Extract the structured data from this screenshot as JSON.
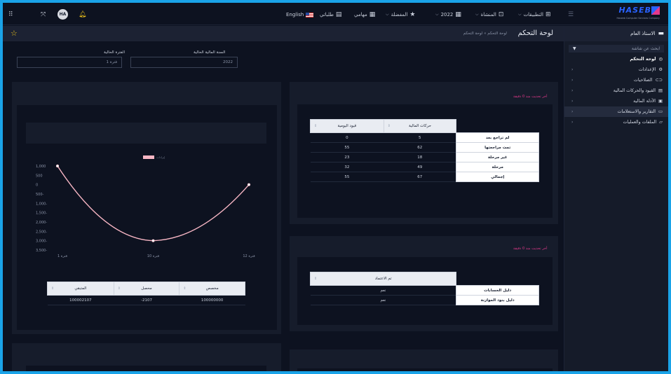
{
  "topbar": {
    "language": "English",
    "print_label": "طلباتي",
    "tasks_label": "مهامي",
    "year_label": "2022",
    "favorites_label": "المفضلة",
    "facility_label": "المنشاة",
    "apps_label": "التطبيقات",
    "avatar_initials": "HA",
    "logo_word": "HASEB",
    "logo_sub": "Haseeb Computer Services Company"
  },
  "breadcrumb": {
    "title": "لوحة التحكم",
    "path": "لوحة التحكم  »  لوحة التحكم"
  },
  "sidebar": {
    "header": "الاستاذ العام",
    "search_placeholder": "ابحث عن شاشة",
    "items": [
      {
        "label": "لوحة التحكم",
        "chevron": false
      },
      {
        "label": "الإعدادات",
        "chevron": true
      },
      {
        "label": "الصلاحيات",
        "chevron": true
      },
      {
        "label": "القيود والحركات المالية",
        "chevron": true
      },
      {
        "label": "الأدلة المالية",
        "chevron": true
      },
      {
        "label": "التقارير والاستعلامات",
        "chevron": true
      },
      {
        "label": "الملفات والعمليات",
        "chevron": true
      }
    ]
  },
  "filters": {
    "year_label": "السنة المالية الحالية",
    "year_value": "2022",
    "period_label": "الفترة الحالية",
    "period_value": "فترة 1"
  },
  "status_table": {
    "updated": "أخر تحديث منذ 0 دقيقة",
    "columns": [
      "حركات المالية",
      "قيود اليومية"
    ],
    "rows": [
      {
        "label": "لم تراجع بعد",
        "values": [
          "5",
          "0"
        ]
      },
      {
        "label": "تمت مراجعتها",
        "values": [
          "62",
          "55"
        ]
      },
      {
        "label": "غير مرحلة",
        "values": [
          "18",
          "23"
        ]
      },
      {
        "label": "مرحلة",
        "values": [
          "49",
          "32"
        ]
      },
      {
        "label": "إجمالي",
        "values": [
          "67",
          "55"
        ]
      }
    ]
  },
  "approval_table": {
    "updated": "أخر تحديث منذ 0 دقيقة",
    "columns": [
      "تم الاعتماد"
    ],
    "rows": [
      {
        "label": "دليل الحسابات",
        "values": [
          "نعم"
        ]
      },
      {
        "label": "دليل بنود الموازنة",
        "values": [
          "نعم"
        ]
      }
    ]
  },
  "budget_table": {
    "columns": [
      "مخصص",
      "محصل",
      "المتبقي"
    ],
    "row": [
      "100000000",
      "2107-",
      "100002107"
    ]
  },
  "chart_data": {
    "type": "line",
    "legend": "إيرادات",
    "x": [
      "فترة 1",
      "فترة 10",
      "فترة 12"
    ],
    "series": [
      {
        "name": "إيرادات",
        "values": [
          1000,
          -3000,
          0
        ]
      }
    ],
    "yticks": [
      "1,000",
      "500",
      "0",
      "500-",
      "1,000-",
      "1,500-",
      "2,000-",
      "2,500-",
      "3,000-",
      "3,500-"
    ],
    "ylim": [
      -3500,
      1000
    ],
    "line_color": "#f7b6c4"
  },
  "colors": {
    "accent": "#e5398c",
    "brand": "#2962ff",
    "background": "#0d1220",
    "card": "#161c2b"
  }
}
